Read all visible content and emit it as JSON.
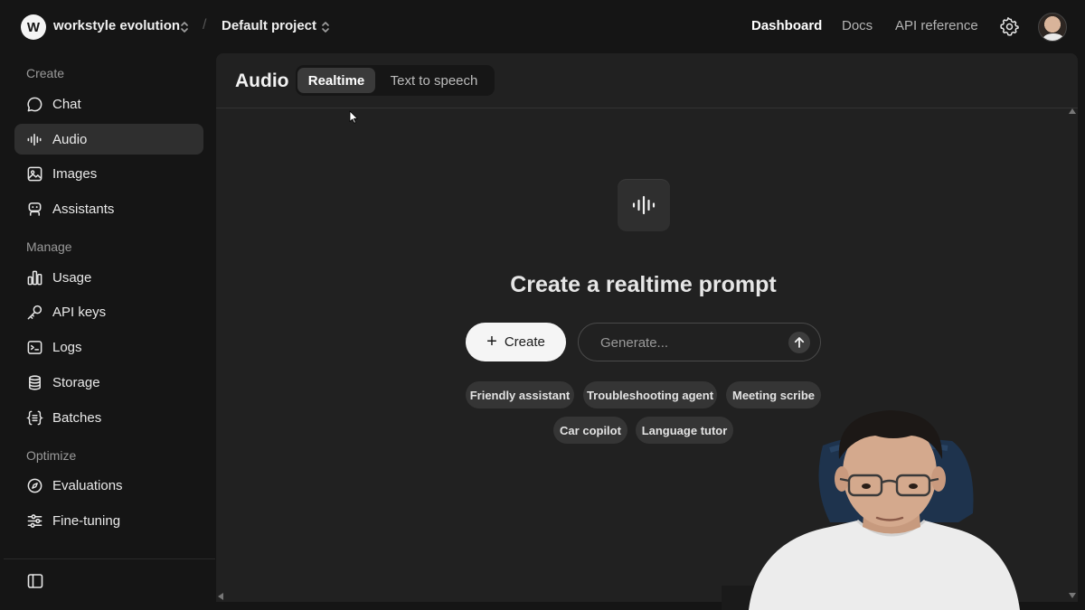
{
  "topbar": {
    "org_initial": "W",
    "org_name": "workstyle evolution",
    "separator": "/",
    "project_name": "Default project",
    "nav": {
      "dashboard": "Dashboard",
      "docs": "Docs",
      "api_reference": "API reference"
    },
    "active_nav": "Dashboard"
  },
  "sidebar": {
    "sections": {
      "create": "Create",
      "manage": "Manage",
      "optimize": "Optimize"
    },
    "items": {
      "chat": "Chat",
      "audio": "Audio",
      "images": "Images",
      "assistants": "Assistants",
      "usage": "Usage",
      "api_keys": "API keys",
      "logs": "Logs",
      "storage": "Storage",
      "batches": "Batches",
      "evaluations": "Evaluations",
      "fine_tuning": "Fine-tuning"
    },
    "active_item": "Audio"
  },
  "main": {
    "title": "Audio",
    "tabs": {
      "realtime": "Realtime",
      "text_to_speech": "Text to speech"
    },
    "active_tab": "Realtime",
    "hero_title": "Create a realtime prompt",
    "create_label": "Create",
    "generate_placeholder": "Generate...",
    "chips": {
      "friendly_assistant": "Friendly assistant",
      "troubleshooting_agent": "Troubleshooting agent",
      "meeting_scribe": "Meeting scribe",
      "car_copilot": "Car copilot",
      "language_tutor": "Language tutor"
    }
  },
  "icons": {
    "settings": "gear-icon",
    "audio": "waveform-icon",
    "send": "arrow-up-icon"
  },
  "colors": {
    "background": "#151515",
    "panel": "#212121",
    "active_item": "#2f2f2f",
    "chip": "#353535",
    "primary_button": "#f5f5f5"
  }
}
